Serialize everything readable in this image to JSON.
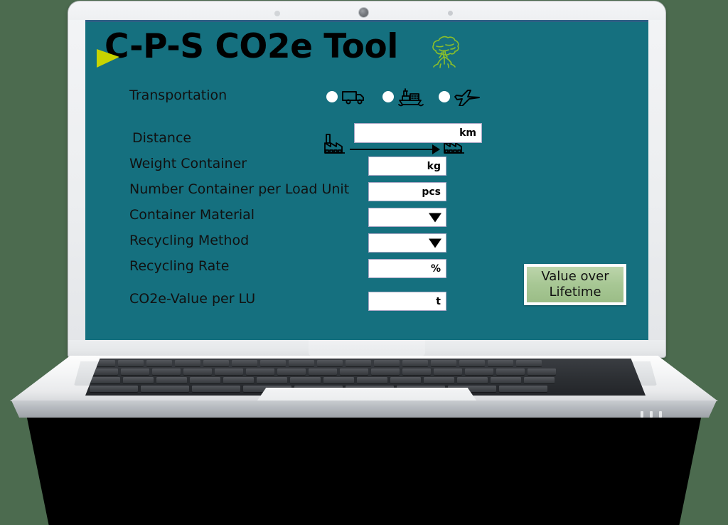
{
  "app": {
    "title": "C-P-S CO2e Tool",
    "logo_icon": "green-triangle-logo",
    "tree_icon": "tree-icon",
    "screen_bg": "#15707f",
    "accent_green": "#c8d400",
    "button_green": "#a7c794"
  },
  "device": {
    "type": "laptop-mockup",
    "webcam_icon": "webcam-icon",
    "indicator_left_icon": "indicator-dot-icon",
    "indicator_right_icon": "indicator-dot-icon"
  },
  "form": {
    "transportation": {
      "label": "Transportation",
      "options": [
        {
          "id": "truck",
          "icon": "truck-icon",
          "selected": false
        },
        {
          "id": "ship",
          "icon": "ship-icon",
          "selected": false
        },
        {
          "id": "plane",
          "icon": "plane-icon",
          "selected": false
        }
      ]
    },
    "distance": {
      "label": "Distance",
      "unit": "km",
      "value": "",
      "origin_icon": "factory-icon",
      "destination_icon": "factory-icon",
      "arrow_icon": "arrow-right-icon"
    },
    "fields": [
      {
        "label": "Weight Container",
        "unit": "kg",
        "value": "",
        "type": "text"
      },
      {
        "label": "Number Container per Load Unit",
        "unit": "pcs",
        "value": "",
        "type": "text"
      },
      {
        "label": "Container Material",
        "unit": "",
        "value": "",
        "type": "dropdown"
      },
      {
        "label": "Recycling Method",
        "unit": "",
        "value": "",
        "type": "dropdown"
      },
      {
        "label": "Recycling Rate",
        "unit": "%",
        "value": "",
        "type": "text"
      },
      {
        "label": "CO2e-Value per LU",
        "unit": "t",
        "value": "",
        "type": "text"
      }
    ],
    "button": {
      "line1": "Value over",
      "line2": "Lifetime"
    }
  }
}
